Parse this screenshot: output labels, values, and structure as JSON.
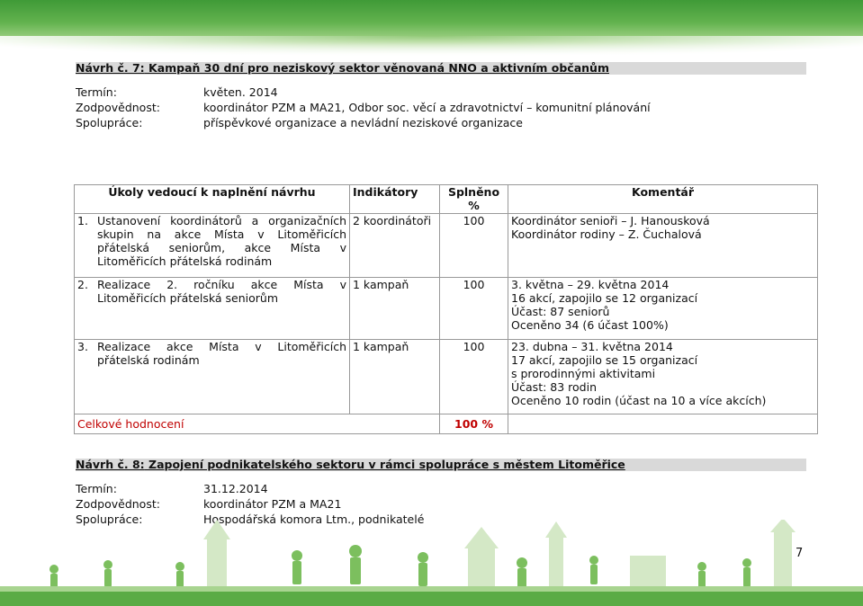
{
  "proposal7": {
    "prefix": "Návrh č. 7:",
    "title": " Kampaň 30 dní pro neziskový sektor věnovaná NNO a aktivním občanům",
    "meta": [
      {
        "key": "Termín:",
        "value": "květen. 2014"
      },
      {
        "key": "Zodpovědnost:",
        "value": "koordinátor PZM a MA21, Odbor soc. věcí a zdravotnictví – komunitní plánování"
      },
      {
        "key": "Spolupráce:",
        "value": "příspěvkové organizace a nevládní neziskové organizace"
      }
    ]
  },
  "table": {
    "headers": {
      "tasks": "Úkoly vedoucí k naplnění návrhu",
      "indicators": "Indikátory",
      "done": "Splněno %",
      "comment": "Komentář"
    },
    "rows": [
      {
        "num": "1.",
        "task": "Ustanovení koordinátorů a organizačních skupin na akce Místa v Litoměřicích přátelská seniorům, akce Místa v Litoměřicích přátelská rodinám",
        "indicator": "2 koordinátoři",
        "done": "100",
        "comment": [
          "Koordinátor senioři – J. Hanousková",
          "Koordinátor rodiny – Z. Čuchalová"
        ]
      },
      {
        "num": "2.",
        "task": "Realizace 2. ročníku akce Místa v Litoměřicích přátelská seniorům",
        "indicator": "1 kampaň",
        "done": "100",
        "comment": [
          "3. května – 29. května 2014",
          "16 akcí, zapojilo se 12 organizací",
          "Účast: 87 seniorů",
          "Oceněno 34 (6 účast 100%)"
        ]
      },
      {
        "num": "3.",
        "task": "Realizace akce Místa v Litoměřicích přátelská rodinám",
        "indicator": "1 kampaň",
        "done": "100",
        "comment": [
          "23. dubna – 31. května 2014",
          "17 akcí, zapojilo se 15 organizací",
          "s prorodinnými aktivitami",
          "Účast: 83 rodin",
          "Oceněno 10 rodin (účast na 10 a více akcích)"
        ]
      }
    ],
    "total_label": "Celkové hodnocení",
    "total_value": "100 %"
  },
  "proposal8": {
    "prefix": "Návrh č. 8:",
    "title": " Zapojení podnikatelského sektoru v rámci spolupráce s městem Litoměřice",
    "meta": [
      {
        "key": "Termín:",
        "value": "31.12.2014"
      },
      {
        "key": "Zodpovědnost:",
        "value": "koordinátor PZM a MA21"
      },
      {
        "key": "Spolupráce:",
        "value": "Hospodářská komora Ltm., podnikatelé"
      }
    ]
  },
  "page_number": "7",
  "colors": {
    "accent_red": "#c00000",
    "heading_bg": "#d9d9d9",
    "green": "#5aab45"
  }
}
